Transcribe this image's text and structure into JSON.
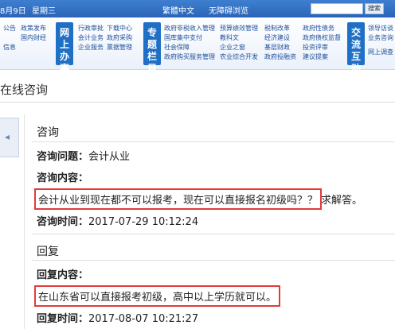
{
  "topbar": {
    "date": "8月9日",
    "weekday": "星期三",
    "traditional": "繁體中文",
    "accessible": "无障碍浏览",
    "search_button": "搜索"
  },
  "nav": {
    "col1": [
      "公告",
      "信息"
    ],
    "col1b": [
      "政策发布",
      "国内财经"
    ],
    "badge1": "网上办事",
    "col2": [
      "行政审批",
      "会计业务",
      "企业服务"
    ],
    "col2b": [
      "下载中心",
      "政府采购",
      "票据管理"
    ],
    "badge2": "专题栏目",
    "col3": [
      "政府非税收入管理",
      "国库集中支付",
      "社会保障",
      "政府购买服务管理"
    ],
    "col3b": [
      "预算绩效管理",
      "教科文",
      "企业之窗",
      "农业综合开发"
    ],
    "col3c": [
      "税制改革",
      "经济建设",
      "基层财政",
      "政府投融资"
    ],
    "col3d": [
      "政府性债务",
      "政府债权监督",
      "投资评审",
      "建议提案"
    ],
    "badge3": "交流互动",
    "col4": [
      "领导访谈",
      "业务咨询",
      "网上调查"
    ]
  },
  "page_title": "在线咨询",
  "consult": {
    "section_title": "咨询",
    "question_label": "咨询问题：",
    "question_value": "会计从业",
    "content_label": "咨询内容：",
    "content_boxed": "会计从业到现在都不可以报考，现在可以直接报名初级吗？？",
    "content_tail": "求解答。",
    "time_label": "咨询时间：",
    "time_value": "2017-07-29 10:12:24"
  },
  "reply": {
    "section_title": "回复",
    "content_label": "回复内容：",
    "content_boxed": "在山东省可以直接报考初级，高中以上学历就可以。",
    "time_label": "回复时间：",
    "time_value": "2017-08-07 10:21:27"
  },
  "colors": {
    "accent": "#2a64b8",
    "highlight_box": "#e23b3b"
  }
}
